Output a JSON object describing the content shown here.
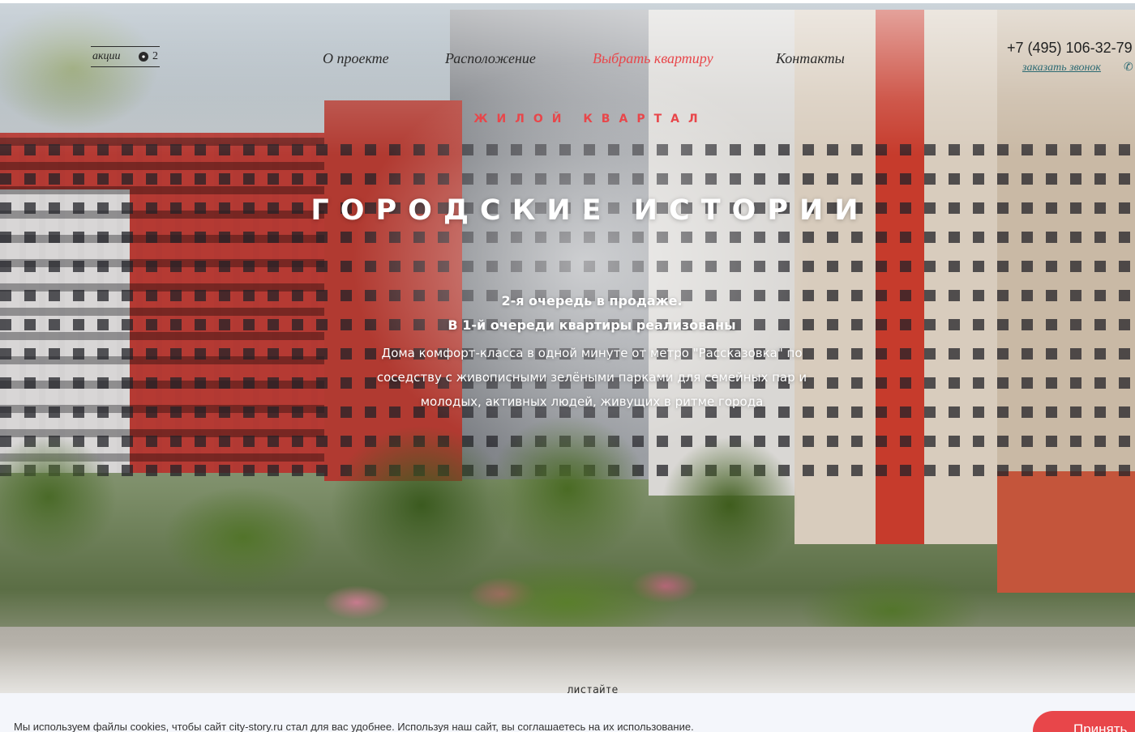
{
  "promo": {
    "label": "акции",
    "count": "2"
  },
  "nav": [
    {
      "label": "О проекте"
    },
    {
      "label": "Расположение"
    },
    {
      "label": "Выбрать квартиру"
    },
    {
      "label": "Контакты"
    }
  ],
  "contact": {
    "phone": "+7 (495) 106-32-79",
    "callback": "заказать звонок"
  },
  "hero": {
    "kicker": "ЖИЛОЙ КВАРТАЛ",
    "title": "ГОРОДСКИЕ ИСТОРИИ",
    "subtitle_1": "2-я очередь в продаже.",
    "subtitle_2": "В 1-й очереди квартиры реализованы",
    "description": "Дома комфорт-класса в одной минуте от метро \"Рассказовка\" по соседству с живописными зелёными парками для семейных пар и молодых, активных людей, живущих в ритме города",
    "scroll_hint": "листайте"
  },
  "cookie_banner": {
    "text": "Мы используем файлы cookies, чтобы сайт city-story.ru стал для вас удобнее. Используя наш сайт, вы соглашаетесь на их использование.",
    "accept": "Принять"
  },
  "colors": {
    "accent": "#e8464a",
    "link": "#2c6a73",
    "banner_bg": "#f4f6fb"
  },
  "icons": {
    "promo": "gear-badge-icon",
    "phone": "phone-icon"
  }
}
